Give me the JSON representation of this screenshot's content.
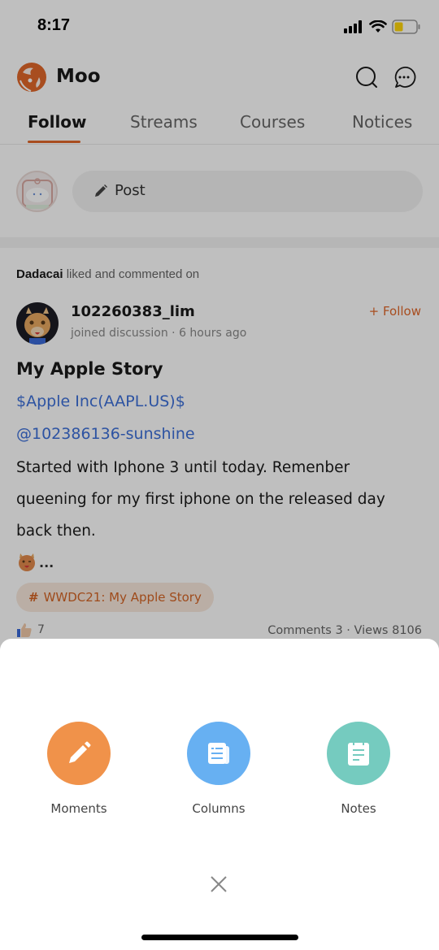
{
  "status_bar": {
    "time": "8:17",
    "icons": [
      "cellular-signal-icon",
      "wifi-icon",
      "battery-icon"
    ]
  },
  "header": {
    "app_name": "Moo",
    "icons": [
      "search-icon",
      "messages-icon"
    ]
  },
  "tabs": [
    {
      "label": "Follow",
      "active": true
    },
    {
      "label": "Streams",
      "active": false
    },
    {
      "label": "Courses",
      "active": false
    },
    {
      "label": "Notices",
      "active": false
    }
  ],
  "composer": {
    "post_label": "Post",
    "icon": "pencil-icon"
  },
  "feed": {
    "activity_user": "Dadacai",
    "activity_text": " liked and commented on",
    "author_name": "102260383_lim",
    "author_meta": "joined discussion · 6 hours ago",
    "follow_label": "+ Follow",
    "title": "My Apple Story",
    "stock_link": "$Apple Inc(AAPL.US)$",
    "mention": "@102386136-sunshine",
    "body": "Started with Iphone 3 until today. Remenber queening for my first iphone on the released day back then.",
    "ellipsis": "...",
    "topic": "WWDC21: My Apple Story",
    "like_count": "7",
    "stats": "Comments 3 · Views 8106"
  },
  "sheet": {
    "options": [
      {
        "label": "Moments",
        "icon": "pencil-icon",
        "color": "#f0924a"
      },
      {
        "label": "Columns",
        "icon": "newspaper-icon",
        "color": "#67b0f2"
      },
      {
        "label": "Notes",
        "icon": "notepad-icon",
        "color": "#75cbbf"
      }
    ],
    "close_icon": "close-icon"
  },
  "colors": {
    "accent": "#e0672a",
    "link": "#3c6fd8",
    "overlay": "rgba(0,0,0,0.25)"
  }
}
